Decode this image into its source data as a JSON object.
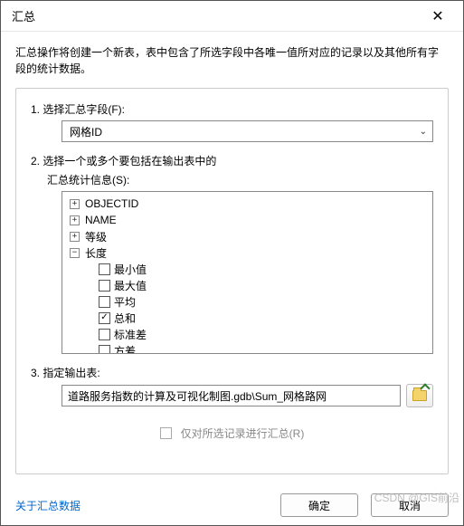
{
  "title": "汇总",
  "description": "汇总操作将创建一个新表，表中包含了所选字段中各唯一值所对应的记录以及其他所有字段的统计数据。",
  "section1": {
    "label": "1. 选择汇总字段(F):",
    "value": "网格ID"
  },
  "section2": {
    "label": "2. 选择一个或多个要包括在输出表中的",
    "sub": "汇总统计信息(S):",
    "nodes": {
      "n0": {
        "exp": "+",
        "label": "OBJECTID"
      },
      "n1": {
        "exp": "+",
        "label": "NAME"
      },
      "n2": {
        "exp": "+",
        "label": "等级"
      },
      "n3": {
        "exp": "−",
        "label": "长度"
      }
    },
    "children": {
      "c0": {
        "label": "最小值",
        "checked": false
      },
      "c1": {
        "label": "最大值",
        "checked": false
      },
      "c2": {
        "label": "平均",
        "checked": false
      },
      "c3": {
        "label": "总和",
        "checked": true
      },
      "c4": {
        "label": "标准差",
        "checked": false
      },
      "c5": {
        "label": "方差",
        "checked": false
      }
    }
  },
  "section3": {
    "label": "3. 指定输出表:",
    "value": "道路服务指数的计算及可视化制图.gdb\\Sum_网格路网"
  },
  "selOnly": "仅对所选记录进行汇总(R)",
  "footer": {
    "link": "关于汇总数据",
    "ok": "确定",
    "cancel": "取消"
  },
  "watermark": "CSDN @GIS前沿"
}
